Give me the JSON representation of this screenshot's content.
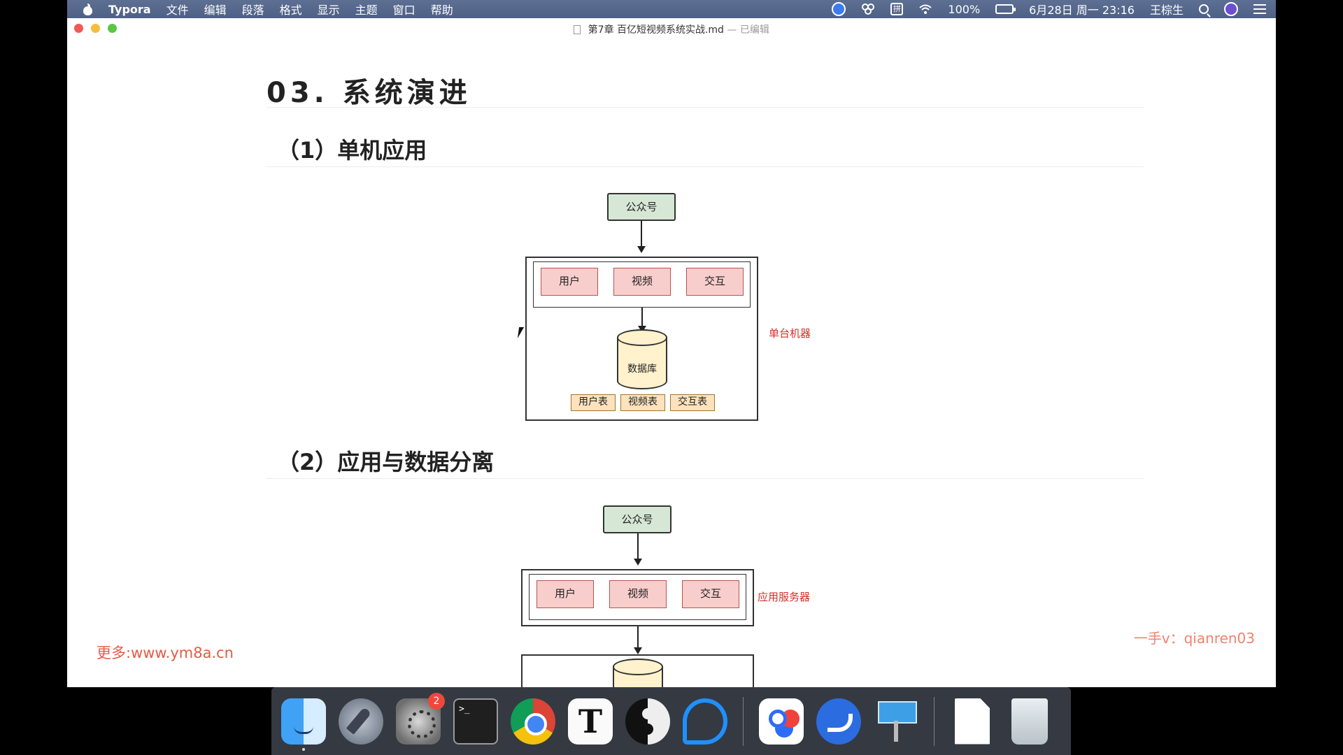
{
  "menubar": {
    "app_name": "Typora",
    "menus": [
      "文件",
      "编辑",
      "段落",
      "格式",
      "显示",
      "主题",
      "窗口",
      "帮助"
    ],
    "ime_label": "拼",
    "battery": "100%",
    "datetime": "6月28日 周一 23:16",
    "user": "王棕生"
  },
  "window": {
    "title": "第7章 百亿短视频系统实战.md",
    "title_suffix": "— 已编辑"
  },
  "doc": {
    "heading": "03. 系统演进",
    "section1": {
      "title": "（1）单机应用",
      "public_account": "公众号",
      "modules": [
        "用户",
        "视频",
        "交互"
      ],
      "db": "数据库",
      "tables": [
        "用户表",
        "视频表",
        "交互表"
      ],
      "label": "单台机器"
    },
    "section2": {
      "title": "（2）应用与数据分离",
      "public_account": "公众号",
      "modules": [
        "用户",
        "视频",
        "交互"
      ],
      "label": "应用服务器"
    }
  },
  "watermarks": {
    "left": "更多:www.ym8a.cn",
    "right": "一手v：qianren03"
  },
  "dock": {
    "sysprefs_badge": "2",
    "terminal_text": ">_",
    "typora_letter": "T",
    "items": [
      "finder",
      "launchpad",
      "system-preferences",
      "terminal",
      "chrome",
      "typora",
      "yinyang-app",
      "chat-app",
      "baidu-netdisk",
      "feishu",
      "keynote",
      "file",
      "trash"
    ]
  },
  "colors": {
    "green_fill": "#d6e8d5",
    "pink_fill": "#f8cecc",
    "orange_fill": "#fde2bd",
    "db_fill": "#fff2cc",
    "label_red": "#d3302b",
    "watermark": "#e35b45"
  }
}
